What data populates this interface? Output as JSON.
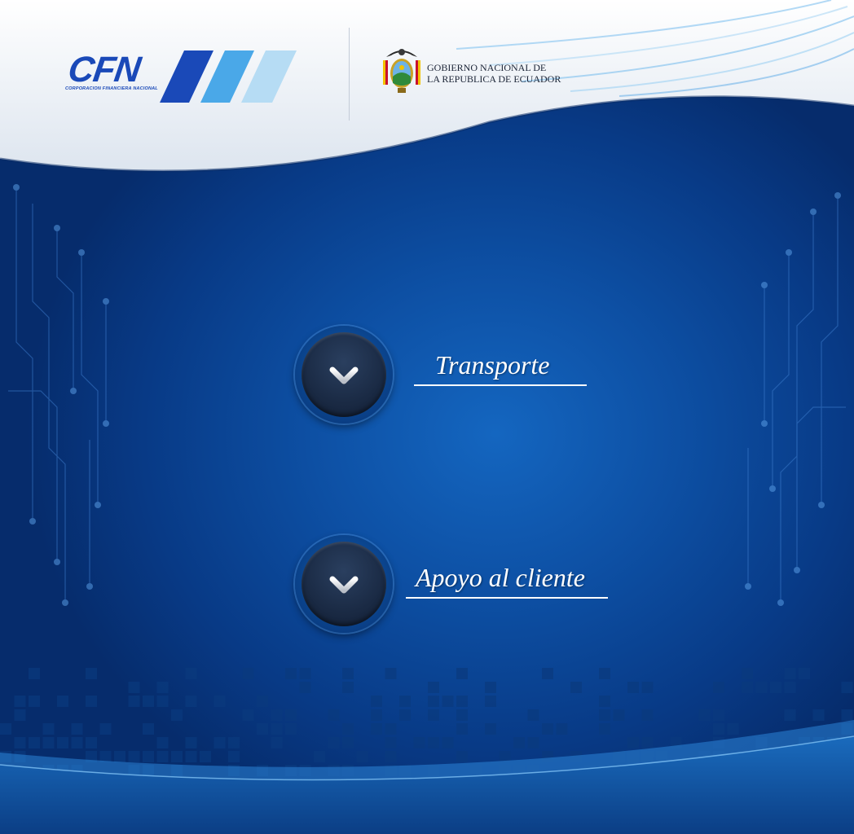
{
  "brand": {
    "cfn_logo_text": "CFN",
    "cfn_subtitle": "CORPORACION FINANCIERA NACIONAL"
  },
  "government": {
    "line1": "GOBIERNO NACIONAL DE",
    "line2": "LA REPUBLICA DE ECUADOR"
  },
  "menu": [
    {
      "label": "Transporte",
      "icon": "chevron-down-icon"
    },
    {
      "label": "Apoyo al cliente",
      "icon": "chevron-down-icon"
    }
  ],
  "colors": {
    "background": "#0d4fa3",
    "brand_blue": "#1a49b8",
    "light_blue": "#4aa8e8",
    "pale_blue": "#b6dcf4",
    "button_dark": "#1a2a44",
    "text_white": "#ffffff"
  }
}
